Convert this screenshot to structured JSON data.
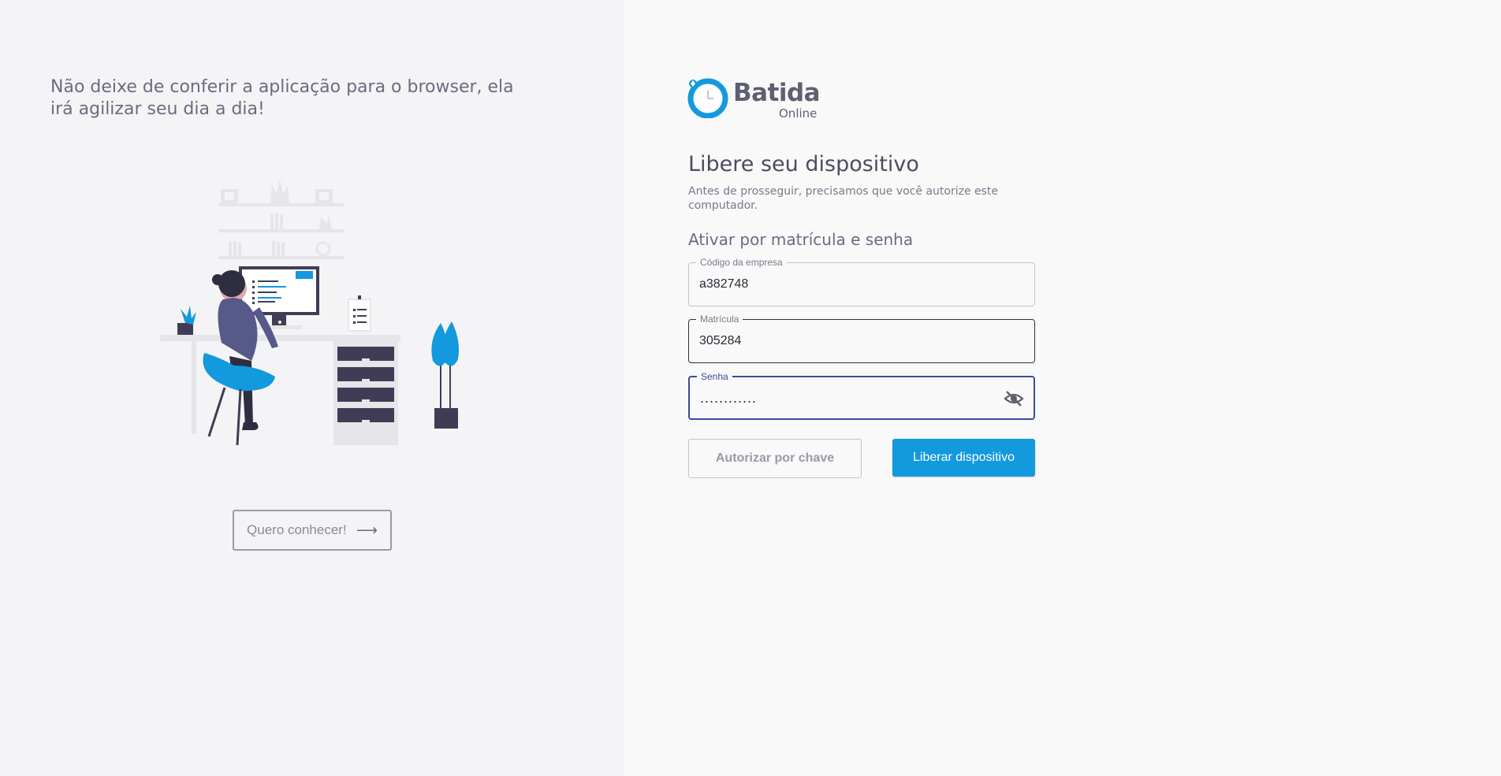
{
  "promo": {
    "text": "Não deixe de conferir a aplicação para o browser, ela irá agilizar seu dia a dia!",
    "button_label": "Quero conhecer!",
    "button_arrow": "⟶"
  },
  "logo": {
    "name": "Batida",
    "sub": "Online"
  },
  "form": {
    "title": "Libere seu dispositivo",
    "subtitle": "Antes de prosseguir, precisamos que você autorize este computador.",
    "section": "Ativar por matrícula e senha",
    "fields": [
      {
        "label": "Código da empresa",
        "value": "a382748"
      },
      {
        "label": "Matrícula",
        "value": "305284"
      },
      {
        "label": "Senha",
        "value": "............"
      }
    ],
    "secondary_button": "Autorizar por chave",
    "primary_button": "Liberar dispositivo"
  },
  "icons": {
    "password_toggle": "eye-off-icon",
    "promo_arrow": "arrow-right-icon"
  },
  "colors": {
    "accent": "#1399de",
    "focus": "#3b4aa0",
    "text_muted": "#6b6b80",
    "left_bg": "#f4f4f6",
    "right_bg": "#f9f9fa"
  }
}
